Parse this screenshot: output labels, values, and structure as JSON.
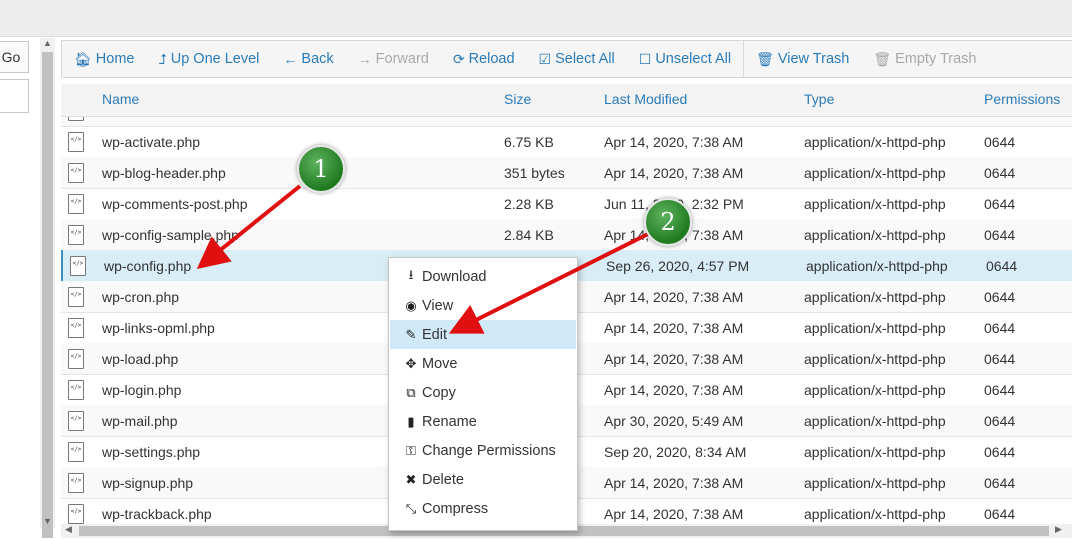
{
  "left": {
    "go_label": "Go"
  },
  "toolbar": {
    "home": {
      "label": "Home",
      "icon": "home-icon"
    },
    "up": {
      "label": "Up One Level",
      "icon": "level-up-icon"
    },
    "back": {
      "label": "Back",
      "icon": "arrow-left-icon"
    },
    "forward": {
      "label": "Forward",
      "icon": "arrow-right-icon"
    },
    "reload": {
      "label": "Reload",
      "icon": "refresh-icon"
    },
    "select_all": {
      "label": "Select All",
      "icon": "checkbox-checked-icon"
    },
    "unselect_all": {
      "label": "Unselect All",
      "icon": "checkbox-empty-icon"
    },
    "view_trash": {
      "label": "View Trash",
      "icon": "trash-icon"
    },
    "empty_trash": {
      "label": "Empty Trash",
      "icon": "trash-icon"
    }
  },
  "table": {
    "headers": {
      "name": "Name",
      "size": "Size",
      "modified": "Last Modified",
      "type": "Type",
      "permissions": "Permissions"
    },
    "rows": [
      {
        "name": "wp-activate.php",
        "size": "6.75 KB",
        "modified": "Apr 14, 2020, 7:38 AM",
        "type": "application/x-httpd-php",
        "perm": "0644"
      },
      {
        "name": "wp-blog-header.php",
        "size": "351 bytes",
        "modified": "Apr 14, 2020, 7:38 AM",
        "type": "application/x-httpd-php",
        "perm": "0644"
      },
      {
        "name": "wp-comments-post.php",
        "size": "2.28 KB",
        "modified": "Jun 11, 2020, 2:32 PM",
        "type": "application/x-httpd-php",
        "perm": "0644"
      },
      {
        "name": "wp-config-sample.php",
        "size": "2.84 KB",
        "modified": "Apr 14, 2020, 7:38 AM",
        "type": "application/x-httpd-php",
        "perm": "0644"
      },
      {
        "name": "wp-config.php",
        "size": "",
        "modified": "Sep 26, 2020, 4:57 PM",
        "type": "application/x-httpd-php",
        "perm": "0644"
      },
      {
        "name": "wp-cron.php",
        "size": "",
        "modified": "Apr 14, 2020, 7:38 AM",
        "type": "application/x-httpd-php",
        "perm": "0644"
      },
      {
        "name": "wp-links-opml.php",
        "size": "",
        "modified": "Apr 14, 2020, 7:38 AM",
        "type": "application/x-httpd-php",
        "perm": "0644"
      },
      {
        "name": "wp-load.php",
        "size": "",
        "modified": "Apr 14, 2020, 7:38 AM",
        "type": "application/x-httpd-php",
        "perm": "0644"
      },
      {
        "name": "wp-login.php",
        "size": "",
        "modified": "Apr 14, 2020, 7:38 AM",
        "type": "application/x-httpd-php",
        "perm": "0644"
      },
      {
        "name": "wp-mail.php",
        "size": "",
        "modified": "Apr 30, 2020, 5:49 AM",
        "type": "application/x-httpd-php",
        "perm": "0644"
      },
      {
        "name": "wp-settings.php",
        "size": "",
        "modified": "Sep 20, 2020, 8:34 AM",
        "type": "application/x-httpd-php",
        "perm": "0644"
      },
      {
        "name": "wp-signup.php",
        "size": "",
        "modified": "Apr 14, 2020, 7:38 AM",
        "type": "application/x-httpd-php",
        "perm": "0644"
      },
      {
        "name": "wp-trackback.php",
        "size": "",
        "modified": "Apr 14, 2020, 7:38 AM",
        "type": "application/x-httpd-php",
        "perm": "0644"
      }
    ]
  },
  "context_menu": {
    "items": [
      {
        "label": "Download",
        "icon": "download-icon"
      },
      {
        "label": "View",
        "icon": "eye-icon"
      },
      {
        "label": "Edit",
        "icon": "pencil-icon"
      },
      {
        "label": "Move",
        "icon": "move-icon"
      },
      {
        "label": "Copy",
        "icon": "copy-icon"
      },
      {
        "label": "Rename",
        "icon": "file-icon"
      },
      {
        "label": "Change Permissions",
        "icon": "key-icon"
      },
      {
        "label": "Delete",
        "icon": "close-icon"
      },
      {
        "label": "Compress",
        "icon": "compress-icon"
      }
    ]
  },
  "annotations": {
    "step1": "1",
    "step2": "2"
  },
  "colors": {
    "link": "#2b7bb9",
    "selected_row": "#d9edf7",
    "menu_active": "#d0e9f8",
    "arrow": "#e01010",
    "badge": "#2e8b2e"
  }
}
